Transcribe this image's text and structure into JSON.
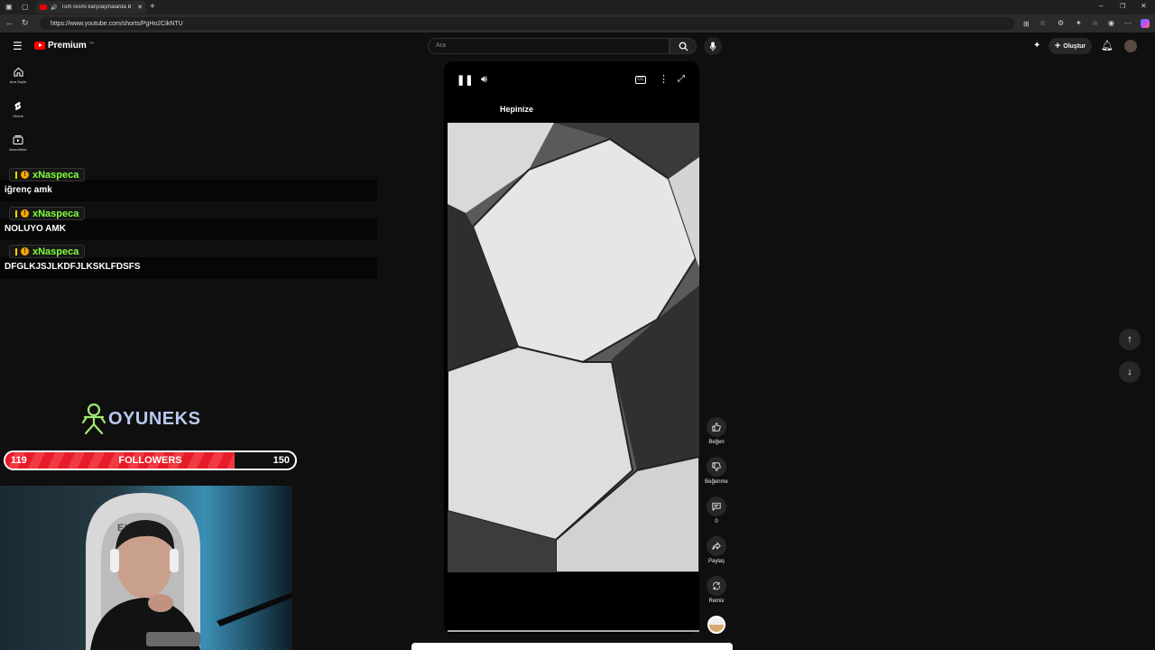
{
  "browser": {
    "tab_title": "Tüm resmi karşılaşmalarda B",
    "url": "https://www.youtube.com/shorts/PgHo2CikNTU"
  },
  "header": {
    "logo_text": "Premium",
    "logo_sup": "TR",
    "search_placeholder": "Ara",
    "create_label": "Oluştur"
  },
  "sidebar": {
    "items": [
      {
        "label": "Ana Sayfa",
        "icon": "home-icon"
      },
      {
        "label": "Shorts",
        "icon": "shorts-icon"
      },
      {
        "label": "Abonelikler",
        "icon": "subscriptions-icon"
      }
    ]
  },
  "chat": {
    "messages": [
      {
        "user": "xNaspeca",
        "text": "iğrenç amk"
      },
      {
        "user": "xNaspeca",
        "text": "NOLUYO AMK"
      },
      {
        "user": "xNaspeca",
        "text": "DFGLKJSJLKDFJLKSKLFDSFS"
      }
    ]
  },
  "overlay": {
    "logo_text": "OYUNEKS",
    "followers_label": "FOLLOWERS",
    "followers_current": "119",
    "followers_goal": "150",
    "followers_fraction": 0.79
  },
  "short": {
    "caption": "Hepinize",
    "actions": {
      "like_label": "Beğen",
      "dislike_label": "Beğenme",
      "comment_count": "0",
      "share_label": "Paylaş",
      "remix_label": "Remix"
    }
  },
  "colors": {
    "accent_red": "#ff0000",
    "chat_name": "#7fff3a",
    "followers_fill": "#e61c28"
  }
}
